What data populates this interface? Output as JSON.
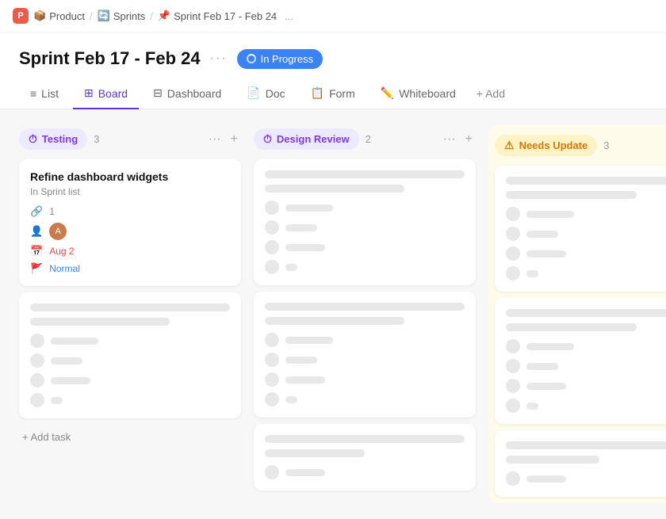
{
  "breadcrumb": {
    "app_name": "P",
    "items": [
      {
        "label": "Product",
        "icon": "📦"
      },
      {
        "label": "Sprints",
        "icon": "🔄"
      },
      {
        "label": "Sprint Feb 17 - Feb 24",
        "icon": "📌"
      }
    ],
    "more_label": "..."
  },
  "page": {
    "title": "Sprint Feb 17 - Feb 24",
    "more_label": "···",
    "status_label": "In Progress"
  },
  "nav": {
    "tabs": [
      {
        "id": "list",
        "label": "List",
        "icon": "≡",
        "active": false
      },
      {
        "id": "board",
        "label": "Board",
        "icon": "⊞",
        "active": true
      },
      {
        "id": "dashboard",
        "label": "Dashboard",
        "icon": "⊟",
        "active": false
      },
      {
        "id": "doc",
        "label": "Doc",
        "icon": "📄",
        "active": false
      },
      {
        "id": "form",
        "label": "Form",
        "icon": "📋",
        "active": false
      },
      {
        "id": "whiteboard",
        "label": "Whiteboard",
        "icon": "✏️",
        "active": false
      }
    ],
    "add_label": "+ Add"
  },
  "board": {
    "columns": [
      {
        "id": "testing",
        "label": "Testing",
        "type": "testing",
        "icon": "⏱",
        "count": 3,
        "cards": [
          {
            "id": "card-1",
            "type": "full",
            "title": "Refine dashboard widgets",
            "subtitle": "In Sprint list",
            "attachments": "1",
            "has_avatar": true,
            "date": "Aug 2",
            "date_red": true,
            "priority": "Normal",
            "priority_type": "normal"
          },
          {
            "id": "card-2",
            "type": "skeleton"
          },
          {
            "id": "card-3",
            "type": "skeleton"
          }
        ],
        "add_task_label": "+ Add task"
      },
      {
        "id": "design-review",
        "label": "Design Review",
        "type": "design-review",
        "icon": "⏱",
        "count": 2,
        "cards": [
          {
            "id": "card-4",
            "type": "skeleton"
          },
          {
            "id": "card-5",
            "type": "skeleton"
          },
          {
            "id": "card-6",
            "type": "skeleton-partial"
          }
        ]
      },
      {
        "id": "needs-update",
        "label": "Needs Update",
        "type": "needs-update",
        "icon": "⚠",
        "count": 3,
        "cards": [
          {
            "id": "card-7",
            "type": "skeleton"
          },
          {
            "id": "card-8",
            "type": "skeleton"
          },
          {
            "id": "card-9",
            "type": "skeleton-partial"
          }
        ]
      }
    ]
  }
}
